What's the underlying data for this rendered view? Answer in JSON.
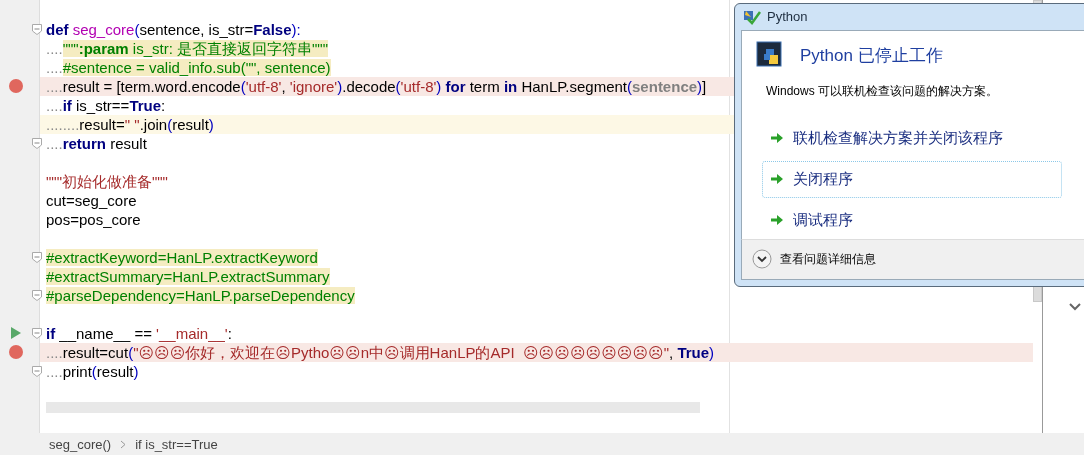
{
  "editor": {
    "lines": [
      {
        "fold": true,
        "tokens": [
          {
            "t": "def",
            "kind": "kw"
          },
          {
            "t": " seg_core",
            "kind": "fn"
          },
          {
            "t": "(",
            "kind": "paren"
          },
          {
            "t": "sentence, is_str=",
            "kind": "plain"
          },
          {
            "t": "False",
            "kind": "kw"
          },
          {
            "t": "):",
            "kind": "paren"
          }
        ]
      },
      {
        "fold": false,
        "tokens": [
          {
            "t": "....",
            "kind": "ws"
          },
          {
            "t": "\"\"\"",
            "kind": "doc"
          },
          {
            "t": ":param",
            "kind": "docb"
          },
          {
            "t": " is_str: 是否直接返回字符串\"\"\"",
            "kind": "doc"
          }
        ]
      },
      {
        "fold": false,
        "tokens": [
          {
            "t": "....",
            "kind": "ws"
          },
          {
            "t": "#sentence = valid_info.sub(\"\", sentence)",
            "kind": "comment"
          }
        ]
      },
      {
        "breakpoint": true,
        "fold": false,
        "tokens": [
          {
            "t": "....",
            "kind": "ws"
          },
          {
            "t": "result = [term.word.encode",
            "kind": "plain"
          },
          {
            "t": "(",
            "kind": "paren"
          },
          {
            "t": "'utf-8'",
            "kind": "str"
          },
          {
            "t": ", ",
            "kind": "plain"
          },
          {
            "t": "'ignore'",
            "kind": "str"
          },
          {
            "t": ")",
            "kind": "paren"
          },
          {
            "t": ".decode",
            "kind": "plain"
          },
          {
            "t": "(",
            "kind": "paren"
          },
          {
            "t": "'utf-8'",
            "kind": "str"
          },
          {
            "t": ")",
            "kind": "paren"
          },
          {
            "t": " for",
            "kind": "kw"
          },
          {
            "t": " term ",
            "kind": "plain"
          },
          {
            "t": "in",
            "kind": "kw"
          },
          {
            "t": " HanLP.segment",
            "kind": "plain"
          },
          {
            "t": "(",
            "kind": "paren"
          },
          {
            "t": "sentence",
            "kind": "param"
          },
          {
            "t": ")",
            "kind": "paren"
          },
          {
            "t": "]",
            "kind": "plain"
          }
        ]
      },
      {
        "fold": false,
        "tokens": [
          {
            "t": "....",
            "kind": "ws"
          },
          {
            "t": "if",
            "kind": "kw"
          },
          {
            "t": " is_str==",
            "kind": "plain"
          },
          {
            "t": "True",
            "kind": "kw"
          },
          {
            "t": ":",
            "kind": "plain"
          }
        ]
      },
      {
        "fold": false,
        "current": true,
        "tokens": [
          {
            "t": "........",
            "kind": "ws"
          },
          {
            "t": "result=",
            "kind": "plain"
          },
          {
            "t": "\" \"",
            "kind": "str"
          },
          {
            "t": ".join",
            "kind": "plain"
          },
          {
            "t": "(",
            "kind": "paren"
          },
          {
            "t": "result",
            "kind": "plain"
          },
          {
            "t": ")",
            "kind": "paren"
          }
        ]
      },
      {
        "fold": true,
        "tokens": [
          {
            "t": "....",
            "kind": "ws"
          },
          {
            "t": "return",
            "kind": "kw"
          },
          {
            "t": " result",
            "kind": "plain"
          }
        ]
      },
      {
        "fold": false
      },
      {
        "fold": false,
        "tokens": [
          {
            "t": "\"\"\"初始化做准备\"\"\"",
            "kind": "str"
          }
        ]
      },
      {
        "fold": false,
        "tokens": [
          {
            "t": "cut=seg_core",
            "kind": "plain"
          }
        ]
      },
      {
        "fold": false,
        "tokens": [
          {
            "t": "pos=pos_core",
            "kind": "plain"
          }
        ]
      },
      {
        "fold": false
      },
      {
        "fold": true,
        "tokens": [
          {
            "t": "#extractKeyword=HanLP.extractKeyword",
            "kind": "comment"
          }
        ]
      },
      {
        "fold": false,
        "tokens": [
          {
            "t": "#extractSummary=HanLP.extractSummary",
            "kind": "comment"
          }
        ]
      },
      {
        "fold": true,
        "tokens": [
          {
            "t": "#parseDependency=HanLP.parseDependency",
            "kind": "comment"
          }
        ]
      },
      {
        "fold": false
      },
      {
        "runnable": true,
        "fold": true,
        "tokens": [
          {
            "t": "if",
            "kind": "kw"
          },
          {
            "t": " __name__ == ",
            "kind": "plain"
          },
          {
            "t": "'__main__'",
            "kind": "str"
          },
          {
            "t": ":",
            "kind": "plain"
          }
        ]
      },
      {
        "breakpoint": true,
        "fold": false,
        "tokens": [
          {
            "t": "....",
            "kind": "ws"
          },
          {
            "t": "result=cut",
            "kind": "plain"
          },
          {
            "t": "(",
            "kind": "paren"
          },
          {
            "t": "\"☹☹☹你好，欢迎在☹Pytho☹☹n中☹调用HanLP的API  ☹☹☹☹☹☹☹☹☹\"",
            "kind": "str"
          },
          {
            "t": ", ",
            "kind": "plain"
          },
          {
            "t": "True",
            "kind": "kw"
          },
          {
            "t": ")",
            "kind": "paren"
          }
        ]
      },
      {
        "fold": true,
        "tokens": [
          {
            "t": "....",
            "kind": "ws"
          },
          {
            "t": "print",
            "kind": "plain"
          },
          {
            "t": "(",
            "kind": "paren"
          },
          {
            "t": "result",
            "kind": "plain"
          },
          {
            "t": ")",
            "kind": "paren"
          }
        ]
      }
    ]
  },
  "breadcrumbs": [
    "seg_core()",
    "if is_str==True"
  ],
  "dialog": {
    "title": "Python",
    "heading": "Python 已停止工作",
    "message": "Windows 可以联机检查该问题的解决方案。",
    "options": [
      {
        "label": "联机检查解决方案并关闭该程序",
        "selected": false
      },
      {
        "label": "关闭程序",
        "selected": true
      },
      {
        "label": "调试程序",
        "selected": false
      }
    ],
    "details": "查看问题详细信息"
  }
}
